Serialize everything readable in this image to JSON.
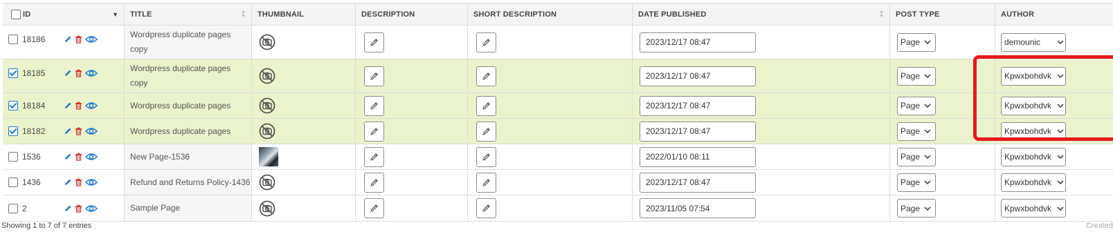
{
  "header": {
    "id": "ID",
    "title": "TITLE",
    "thumbnail": "THUMBNAIL",
    "description": "DESCRIPTION",
    "short_description": "SHORT DESCRIPTION",
    "date_published": "DATE PUBLISHED",
    "post_type": "POST TYPE",
    "author": "AUTHOR"
  },
  "rows": [
    {
      "id": "18186",
      "title_line1": "Wordpress duplicate pages",
      "title_line2": "copy",
      "date": "2023/12/17 08:47",
      "post_type": "Page",
      "author": "demounic",
      "checked": false,
      "thumbnail": "none"
    },
    {
      "id": "18185",
      "title_line1": "Wordpress duplicate pages",
      "title_line2": "copy",
      "date": "2023/12/17 08:47",
      "post_type": "Page",
      "author": "Kpwxbohdvk",
      "checked": true,
      "thumbnail": "none"
    },
    {
      "id": "18184",
      "title": "Wordpress duplicate pages",
      "date": "2023/12/17 08:47",
      "post_type": "Page",
      "author": "Kpwxbohdvk",
      "checked": true,
      "thumbnail": "none"
    },
    {
      "id": "18182",
      "title": "Wordpress duplicate pages",
      "date": "2023/12/17 08:47",
      "post_type": "Page",
      "author": "Kpwxbohdvk",
      "checked": true,
      "thumbnail": "none"
    },
    {
      "id": "1536",
      "title": "New Page-1536",
      "date": "2022/01/10 08:11",
      "post_type": "Page",
      "author": "Kpwxbohdvk",
      "checked": false,
      "thumbnail": "photo"
    },
    {
      "id": "1436",
      "title": "Refund and Returns Policy-1436",
      "date": "2023/12/17 08:47",
      "post_type": "Page",
      "author": "Kpwxbohdvk",
      "checked": false,
      "thumbnail": "none"
    },
    {
      "id": "2",
      "title": "Sample Page",
      "date": "2023/11/05 07:54",
      "post_type": "Page",
      "author": "Kpwxbohdvk",
      "checked": false,
      "thumbnail": "none"
    }
  ],
  "footer": {
    "info": "Showing 1 to 7 of 7 entries",
    "right": "Created"
  },
  "icons": {
    "edit": "pencil-icon",
    "delete": "trash-icon",
    "view": "eye-icon",
    "no_image": "no-image-camera-icon",
    "field_edit": "pencil-icon",
    "dropdown": "chevron-down-icon"
  },
  "colors": {
    "selected_row": "#eaf3cc",
    "highlight_box": "#e51a1a",
    "action_blue": "#1976d2",
    "delete_red": "#d32f2f"
  }
}
